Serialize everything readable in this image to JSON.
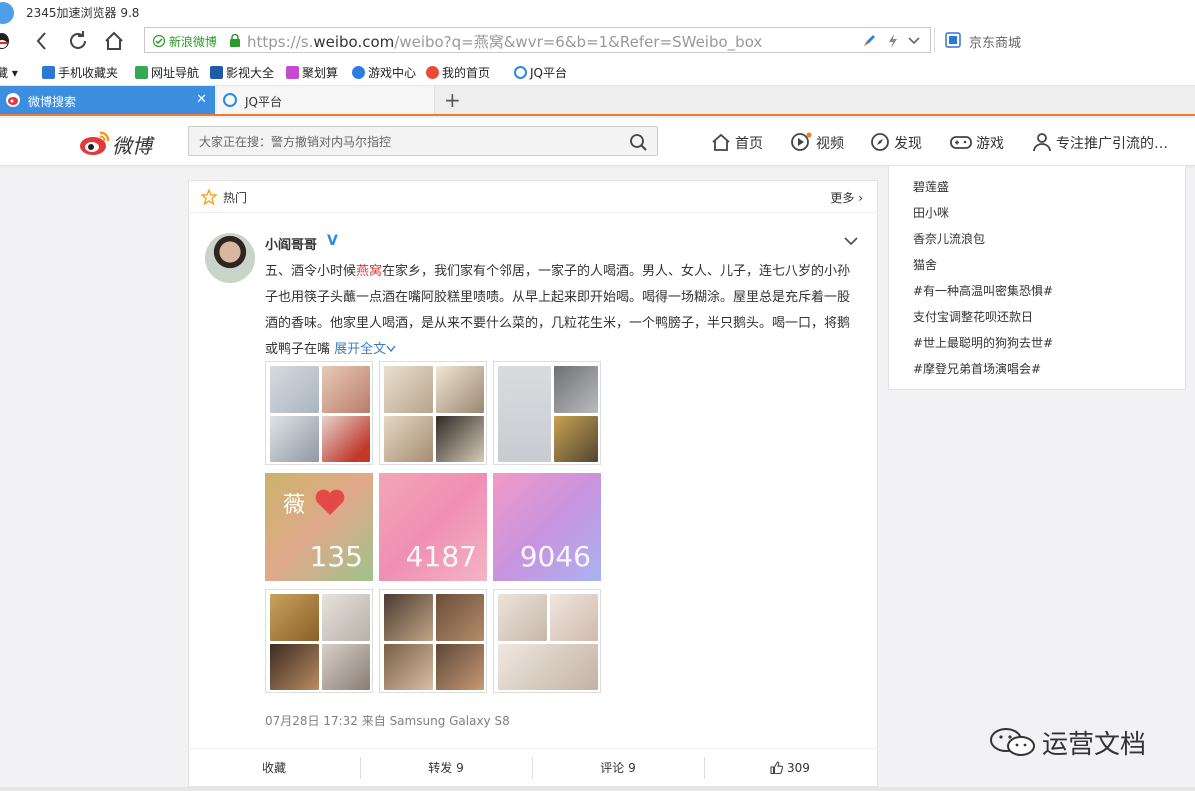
{
  "browser": {
    "title": "2345加速浏览器 9.8",
    "address": {
      "security_label": "新浪微博",
      "url_prefix": "https://s.",
      "url_domain": "weibo.com",
      "url_path": "/weibo?q=燕窝&wvr=6&b=1&Refer=SWeibo_box"
    },
    "side_search_placeholder": "京东商城",
    "bookmarks": [
      {
        "label": "藏",
        "color": "#777777"
      },
      {
        "label": "手机收藏夹",
        "color": "#2b78d6"
      },
      {
        "label": "网址导航",
        "color": "#34a853"
      },
      {
        "label": "影视大全",
        "color": "#1e5ba8"
      },
      {
        "label": "聚划算",
        "color": "#c44bd1"
      },
      {
        "label": "游戏中心",
        "color": "#2d7be4"
      },
      {
        "label": "我的首页",
        "color": "#e94b35"
      },
      {
        "label": "JQ平台",
        "color": "#2b8ae3"
      }
    ],
    "tabs": [
      {
        "label": "微博搜索",
        "active": true
      },
      {
        "label": "JQ平台",
        "active": false
      }
    ]
  },
  "weibo": {
    "logo_text": "微博",
    "search_placeholder": "大家正在搜：警方撤销对内马尔指控",
    "nav": [
      {
        "label": "首页",
        "icon": "home-icon"
      },
      {
        "label": "视频",
        "icon": "video-icon"
      },
      {
        "label": "发现",
        "icon": "compass-icon"
      },
      {
        "label": "游戏",
        "icon": "gamepad-icon"
      },
      {
        "label": "专注推广引流的…",
        "icon": "user-icon"
      }
    ],
    "hot_label": "热门",
    "more_label": "更多 ›",
    "post": {
      "author": "小阎哥哥",
      "verified_mark": "V",
      "text_before": "五、酒令小时候",
      "keyword": "燕窝",
      "text_after": "在家乡，我们家有个邻居，一家子的人喝酒。男人、女人、儿子，连七八岁的小孙子也用筷子头蘸一点酒在嘴阿胶糕里啧啧。从早上起来即开始喝。喝得一场糊涂。屋里总是充斥着一股酒的香味。他家里人喝酒，是从来不要什么菜的，几粒花生米，一个鸭膀子，半只鹅头。喝一口，将鹅或鸭子在嘴",
      "expand_label": "展开全文",
      "overlay_char": "薇",
      "counters": [
        "135",
        "4187",
        "9046"
      ],
      "meta": "07月28日 17:32  来自 Samsung Galaxy S8"
    },
    "actions": {
      "collect": "收藏",
      "repost": "转发 9",
      "comment": "评论 9",
      "like": "309"
    },
    "sidebar_items": [
      "碧莲盛",
      "田小咪",
      "香奈儿流浪包",
      "猫舍",
      "#有一种高温叫密集恐惧#",
      "支付宝调整花呗还款日",
      "#世上最聪明的狗狗去世#",
      "#摩登兄弟首场演唱会#"
    ]
  },
  "watermark": "运营文档",
  "colors": {
    "accent_blue": "#3b8ee0",
    "tab_accent": "#f37a2b",
    "keyword_red": "#e4393c",
    "link_blue": "#3d7fc5"
  }
}
